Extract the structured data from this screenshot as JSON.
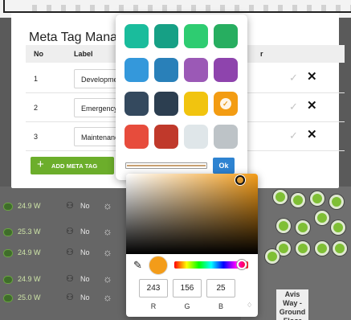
{
  "background": {
    "rows": [
      {
        "watt": "24.9 W",
        "occupancy": "No"
      },
      {
        "watt": "25.3 W",
        "occupancy": "No"
      },
      {
        "watt": "24.9 W",
        "occupancy": "No"
      },
      {
        "watt": "24.9 W",
        "occupancy": "No"
      },
      {
        "watt": "25.0 W",
        "occupancy": "No"
      }
    ],
    "floor_label": "Avis Way - Ground Floor"
  },
  "modal": {
    "title": "Meta Tag Manag",
    "columns": {
      "no": "No",
      "label": "Label",
      "color": "r"
    },
    "rows": [
      {
        "no": "1",
        "label": "Development"
      },
      {
        "no": "2",
        "label": "Emergency"
      },
      {
        "no": "3",
        "label": "Maintenance"
      }
    ],
    "add_button": "ADD META TAG"
  },
  "swatches": {
    "colors": [
      "#1abc9c",
      "#16a085",
      "#2ecc71",
      "#27ae60",
      "#3498db",
      "#2980b9",
      "#9b59b6",
      "#8e44ad",
      "#34495e",
      "#2c3e50",
      "#f1c40f",
      "#f39c12",
      "#e74c3c",
      "#c0392b",
      "#dfe6e9",
      "#bdc3c7"
    ],
    "selected": "#f39c12",
    "ok_label": "Ok"
  },
  "picker": {
    "current_color": "#f39c19",
    "r": "243",
    "g": "156",
    "b": "25",
    "labels": {
      "r": "R",
      "g": "G",
      "b": "B"
    },
    "mode_toggle": "♢"
  }
}
